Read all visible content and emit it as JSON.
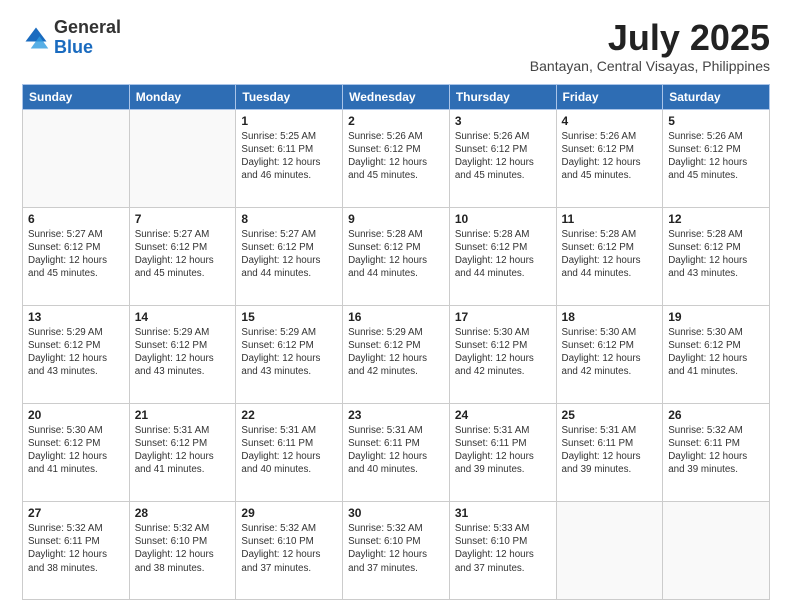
{
  "header": {
    "logo_general": "General",
    "logo_blue": "Blue",
    "month_year": "July 2025",
    "location": "Bantayan, Central Visayas, Philippines"
  },
  "columns": [
    "Sunday",
    "Monday",
    "Tuesday",
    "Wednesday",
    "Thursday",
    "Friday",
    "Saturday"
  ],
  "weeks": [
    [
      {
        "day": "",
        "sunrise": "",
        "sunset": "",
        "daylight": ""
      },
      {
        "day": "",
        "sunrise": "",
        "sunset": "",
        "daylight": ""
      },
      {
        "day": "1",
        "sunrise": "Sunrise: 5:25 AM",
        "sunset": "Sunset: 6:11 PM",
        "daylight": "Daylight: 12 hours and 46 minutes."
      },
      {
        "day": "2",
        "sunrise": "Sunrise: 5:26 AM",
        "sunset": "Sunset: 6:12 PM",
        "daylight": "Daylight: 12 hours and 45 minutes."
      },
      {
        "day": "3",
        "sunrise": "Sunrise: 5:26 AM",
        "sunset": "Sunset: 6:12 PM",
        "daylight": "Daylight: 12 hours and 45 minutes."
      },
      {
        "day": "4",
        "sunrise": "Sunrise: 5:26 AM",
        "sunset": "Sunset: 6:12 PM",
        "daylight": "Daylight: 12 hours and 45 minutes."
      },
      {
        "day": "5",
        "sunrise": "Sunrise: 5:26 AM",
        "sunset": "Sunset: 6:12 PM",
        "daylight": "Daylight: 12 hours and 45 minutes."
      }
    ],
    [
      {
        "day": "6",
        "sunrise": "Sunrise: 5:27 AM",
        "sunset": "Sunset: 6:12 PM",
        "daylight": "Daylight: 12 hours and 45 minutes."
      },
      {
        "day": "7",
        "sunrise": "Sunrise: 5:27 AM",
        "sunset": "Sunset: 6:12 PM",
        "daylight": "Daylight: 12 hours and 45 minutes."
      },
      {
        "day": "8",
        "sunrise": "Sunrise: 5:27 AM",
        "sunset": "Sunset: 6:12 PM",
        "daylight": "Daylight: 12 hours and 44 minutes."
      },
      {
        "day": "9",
        "sunrise": "Sunrise: 5:28 AM",
        "sunset": "Sunset: 6:12 PM",
        "daylight": "Daylight: 12 hours and 44 minutes."
      },
      {
        "day": "10",
        "sunrise": "Sunrise: 5:28 AM",
        "sunset": "Sunset: 6:12 PM",
        "daylight": "Daylight: 12 hours and 44 minutes."
      },
      {
        "day": "11",
        "sunrise": "Sunrise: 5:28 AM",
        "sunset": "Sunset: 6:12 PM",
        "daylight": "Daylight: 12 hours and 44 minutes."
      },
      {
        "day": "12",
        "sunrise": "Sunrise: 5:28 AM",
        "sunset": "Sunset: 6:12 PM",
        "daylight": "Daylight: 12 hours and 43 minutes."
      }
    ],
    [
      {
        "day": "13",
        "sunrise": "Sunrise: 5:29 AM",
        "sunset": "Sunset: 6:12 PM",
        "daylight": "Daylight: 12 hours and 43 minutes."
      },
      {
        "day": "14",
        "sunrise": "Sunrise: 5:29 AM",
        "sunset": "Sunset: 6:12 PM",
        "daylight": "Daylight: 12 hours and 43 minutes."
      },
      {
        "day": "15",
        "sunrise": "Sunrise: 5:29 AM",
        "sunset": "Sunset: 6:12 PM",
        "daylight": "Daylight: 12 hours and 43 minutes."
      },
      {
        "day": "16",
        "sunrise": "Sunrise: 5:29 AM",
        "sunset": "Sunset: 6:12 PM",
        "daylight": "Daylight: 12 hours and 42 minutes."
      },
      {
        "day": "17",
        "sunrise": "Sunrise: 5:30 AM",
        "sunset": "Sunset: 6:12 PM",
        "daylight": "Daylight: 12 hours and 42 minutes."
      },
      {
        "day": "18",
        "sunrise": "Sunrise: 5:30 AM",
        "sunset": "Sunset: 6:12 PM",
        "daylight": "Daylight: 12 hours and 42 minutes."
      },
      {
        "day": "19",
        "sunrise": "Sunrise: 5:30 AM",
        "sunset": "Sunset: 6:12 PM",
        "daylight": "Daylight: 12 hours and 41 minutes."
      }
    ],
    [
      {
        "day": "20",
        "sunrise": "Sunrise: 5:30 AM",
        "sunset": "Sunset: 6:12 PM",
        "daylight": "Daylight: 12 hours and 41 minutes."
      },
      {
        "day": "21",
        "sunrise": "Sunrise: 5:31 AM",
        "sunset": "Sunset: 6:12 PM",
        "daylight": "Daylight: 12 hours and 41 minutes."
      },
      {
        "day": "22",
        "sunrise": "Sunrise: 5:31 AM",
        "sunset": "Sunset: 6:11 PM",
        "daylight": "Daylight: 12 hours and 40 minutes."
      },
      {
        "day": "23",
        "sunrise": "Sunrise: 5:31 AM",
        "sunset": "Sunset: 6:11 PM",
        "daylight": "Daylight: 12 hours and 40 minutes."
      },
      {
        "day": "24",
        "sunrise": "Sunrise: 5:31 AM",
        "sunset": "Sunset: 6:11 PM",
        "daylight": "Daylight: 12 hours and 39 minutes."
      },
      {
        "day": "25",
        "sunrise": "Sunrise: 5:31 AM",
        "sunset": "Sunset: 6:11 PM",
        "daylight": "Daylight: 12 hours and 39 minutes."
      },
      {
        "day": "26",
        "sunrise": "Sunrise: 5:32 AM",
        "sunset": "Sunset: 6:11 PM",
        "daylight": "Daylight: 12 hours and 39 minutes."
      }
    ],
    [
      {
        "day": "27",
        "sunrise": "Sunrise: 5:32 AM",
        "sunset": "Sunset: 6:11 PM",
        "daylight": "Daylight: 12 hours and 38 minutes."
      },
      {
        "day": "28",
        "sunrise": "Sunrise: 5:32 AM",
        "sunset": "Sunset: 6:10 PM",
        "daylight": "Daylight: 12 hours and 38 minutes."
      },
      {
        "day": "29",
        "sunrise": "Sunrise: 5:32 AM",
        "sunset": "Sunset: 6:10 PM",
        "daylight": "Daylight: 12 hours and 37 minutes."
      },
      {
        "day": "30",
        "sunrise": "Sunrise: 5:32 AM",
        "sunset": "Sunset: 6:10 PM",
        "daylight": "Daylight: 12 hours and 37 minutes."
      },
      {
        "day": "31",
        "sunrise": "Sunrise: 5:33 AM",
        "sunset": "Sunset: 6:10 PM",
        "daylight": "Daylight: 12 hours and 37 minutes."
      },
      {
        "day": "",
        "sunrise": "",
        "sunset": "",
        "daylight": ""
      },
      {
        "day": "",
        "sunrise": "",
        "sunset": "",
        "daylight": ""
      }
    ]
  ]
}
